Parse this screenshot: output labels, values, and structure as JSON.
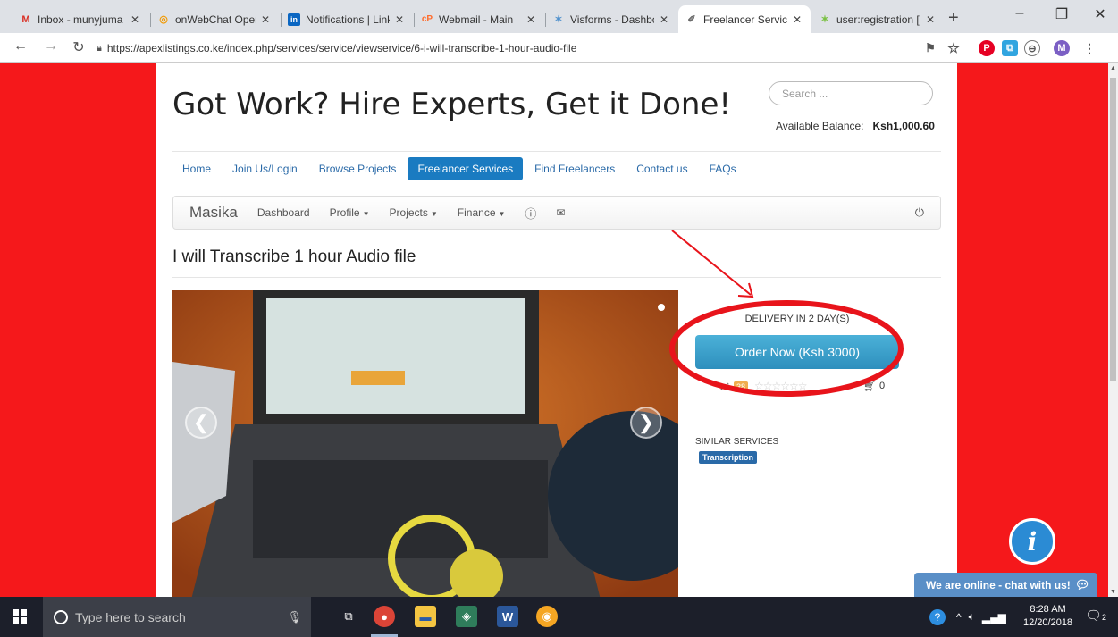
{
  "browser": {
    "tabs": [
      {
        "title": "Inbox - munyjuma",
        "icon": "gmail-icon",
        "color": "#d93025",
        "glyph": "M"
      },
      {
        "title": "onWebChat Opera",
        "icon": "chat-icon",
        "color": "#f29900",
        "glyph": "◎"
      },
      {
        "title": "Notifications | Link",
        "icon": "linkedin-icon",
        "color": "#0a66c2",
        "glyph": "in"
      },
      {
        "title": "Webmail - Main",
        "icon": "cpanel-icon",
        "color": "#ff6c2c",
        "glyph": "cP"
      },
      {
        "title": "Visforms - Dashbo",
        "icon": "joomla-icon",
        "color": "#5091cd",
        "glyph": "✶"
      },
      {
        "title": "Freelancer Service",
        "icon": "freelancer-icon",
        "color": "#444444",
        "glyph": "✐"
      },
      {
        "title": "user:registration [",
        "icon": "joomla-icon",
        "color": "#7ac143",
        "glyph": "✶"
      }
    ],
    "url": "https://apexlistings.co.ke/index.php/services/service/viewservice/6-i-will-transcribe-1-hour-audio-file",
    "profile_initial": "M"
  },
  "site": {
    "title": "Got Work? Hire Experts, Get it Done!",
    "search_placeholder": "Search ...",
    "balance_label": "Available Balance:",
    "balance_value": "Ksh1,000.60",
    "nav": [
      "Home",
      "Join Us/Login",
      "Browse Projects",
      "Freelancer Services",
      "Find Freelancers",
      "Contact us",
      "FAQs"
    ],
    "nav_active": 3,
    "subnav": {
      "brand": "Masika",
      "dashboard": "Dashboard",
      "profile": "Profile",
      "projects": "Projects",
      "finance": "Finance"
    }
  },
  "service": {
    "heading": "I will Transcribe 1 hour Audio file",
    "delivery": "DELIVERY IN 2 DAY(S)",
    "order_label": "Order Now (Ksh 3000)",
    "like_count": "38",
    "cart_count": "0",
    "similar_heading": "SIMILAR SERVICES",
    "similar_tag": "Transcription"
  },
  "chat": {
    "status": "We are online - chat with us!"
  },
  "taskbar": {
    "search_placeholder": "Type here to search",
    "time": "8:28 AM",
    "date": "12/20/2018",
    "notif_count": "2"
  },
  "colors": {
    "page_bg": "#f5181b",
    "accent": "#1a7bc1",
    "annotation": "#e8141b"
  }
}
